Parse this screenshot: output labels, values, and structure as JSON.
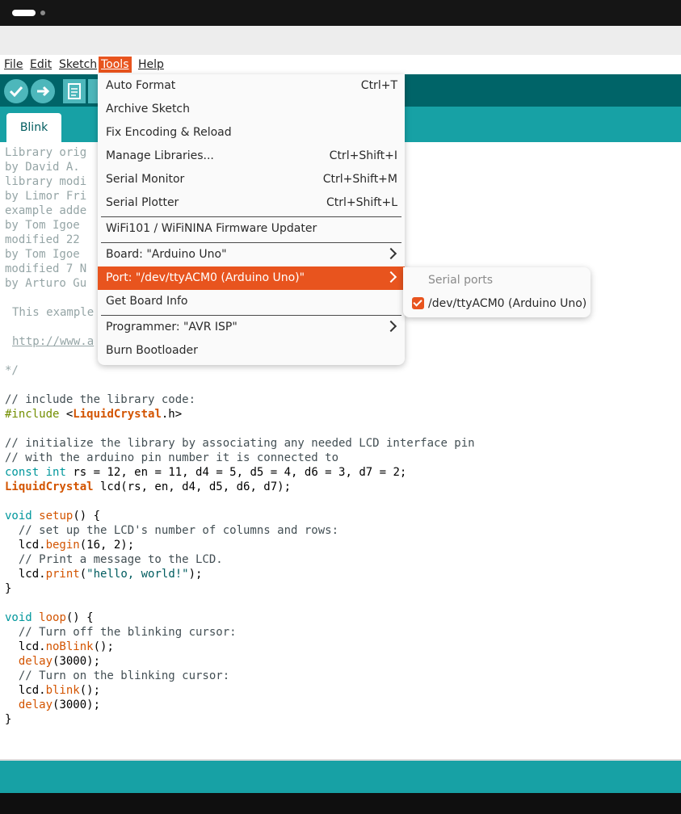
{
  "menubar": {
    "file": "File",
    "edit": "Edit",
    "sketch": "Sketch",
    "tools": "Tools",
    "help": "Help"
  },
  "tabs": [
    {
      "label": "Blink"
    }
  ],
  "tools_menu": {
    "items": [
      {
        "label": "Auto Format",
        "shortcut": "Ctrl+T"
      },
      {
        "label": "Archive Sketch",
        "shortcut": ""
      },
      {
        "label": "Fix Encoding & Reload",
        "shortcut": ""
      },
      {
        "label": "Manage Libraries...",
        "shortcut": "Ctrl+Shift+I"
      },
      {
        "label": "Serial Monitor",
        "shortcut": "Ctrl+Shift+M"
      },
      {
        "label": "Serial Plotter",
        "shortcut": "Ctrl+Shift+L"
      },
      {
        "label": "WiFi101 / WiFiNINA Firmware Updater",
        "shortcut": ""
      },
      {
        "label": "Board: \"Arduino Uno\"",
        "shortcut": ""
      },
      {
        "label": "Port: \"/dev/ttyACM0 (Arduino Uno)\"",
        "shortcut": ""
      },
      {
        "label": "Get Board Info",
        "shortcut": ""
      },
      {
        "label": "Programmer: \"AVR ISP\"",
        "shortcut": ""
      },
      {
        "label": "Burn Bootloader",
        "shortcut": ""
      }
    ]
  },
  "port_submenu": {
    "header": "Serial ports",
    "items": [
      {
        "label": "/dev/ttyACM0 (Arduino Uno)",
        "checked": true
      }
    ]
  },
  "code": {
    "l1": "Library orig",
    "l2": "by David A.",
    "l3": "library modi",
    "l4": "by Limor Fri",
    "l5": "example adde",
    "l6": "by Tom Igoe",
    "l7": "modified 22",
    "l8": "by Tom Igoe",
    "l9": "modified 7 N",
    "l10": "by Arturo Gu",
    "l11": "This example",
    "l12": "http://www.a",
    "l13": "*/",
    "l14": "// include the library code:",
    "l15a": "#include",
    "l15b": " <",
    "l15c": "LiquidCrystal",
    "l15d": ".h>",
    "l16": "// initialize the library by associating any needed LCD interface pin",
    "l17": "// with the arduino pin number it is connected to",
    "l18a": "const",
    "l18b": " ",
    "l18c": "int",
    "l18d": " rs = 12, en = 11, d4 = 5, d5 = 4, d6 = 3, d7 = 2;",
    "l19a": "LiquidCrystal",
    "l19b": " lcd(rs, en, d4, d5, d6, d7);",
    "l20a": "void",
    "l20b": " ",
    "l20c": "setup",
    "l20d": "() {",
    "l21": "  // set up the LCD's number of columns and rows:",
    "l22a": "  lcd.",
    "l22b": "begin",
    "l22c": "(16, 2);",
    "l23": "  // Print a message to the LCD.",
    "l24a": "  lcd.",
    "l24b": "print",
    "l24c": "(",
    "l24d": "\"hello, world!\"",
    "l24e": ");",
    "l25": "}",
    "l26a": "void",
    "l26b": " ",
    "l26c": "loop",
    "l26d": "() {",
    "l27": "  // Turn off the blinking cursor:",
    "l28a": "  lcd.",
    "l28b": "noBlink",
    "l28c": "();",
    "l29a": "  ",
    "l29b": "delay",
    "l29c": "(3000);",
    "l30": "  // Turn on the blinking cursor:",
    "l31a": "  lcd.",
    "l31b": "blink",
    "l31c": "();",
    "l32a": "  ",
    "l32b": "delay",
    "l32c": "(3000);",
    "l33": "}"
  }
}
